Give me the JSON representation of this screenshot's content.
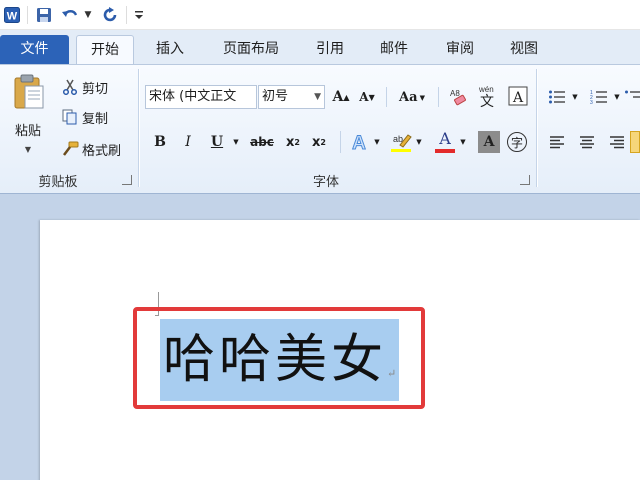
{
  "quick_access": {
    "app_icon": "word-logo-icon",
    "save_icon": "save-icon",
    "undo_icon": "undo-icon",
    "redo_icon": "redo-icon",
    "customize_icon": "customize-qat-icon"
  },
  "tabs": [
    {
      "label": "文件"
    },
    {
      "label": "开始"
    },
    {
      "label": "插入"
    },
    {
      "label": "页面布局"
    },
    {
      "label": "引用"
    },
    {
      "label": "邮件"
    },
    {
      "label": "审阅"
    },
    {
      "label": "视图"
    }
  ],
  "clipboard": {
    "paste_label": "粘贴",
    "cut_label": "剪切",
    "copy_label": "复制",
    "format_painter_label": "格式刷",
    "group_label": "剪贴板"
  },
  "font": {
    "font_name": "宋体 (中文正文",
    "font_size": "初号",
    "grow_label": "A",
    "shrink_label": "A",
    "change_case_label": "Aa",
    "bold_label": "B",
    "italic_label": "I",
    "underline_label": "U",
    "strike_label": "abc",
    "subscript_label": "x",
    "superscript_label": "x",
    "font_color_label": "A",
    "char_shading_label": "A",
    "enclose_label": "字",
    "group_label": "字体",
    "colors": {
      "font_color": "#e32b2b",
      "highlight": "#ffff00"
    }
  },
  "document": {
    "text": "哈哈美女",
    "paragraph_mark": "↵",
    "selection_color": "#a8cdf0",
    "annotation_color": "#e23a3a"
  }
}
